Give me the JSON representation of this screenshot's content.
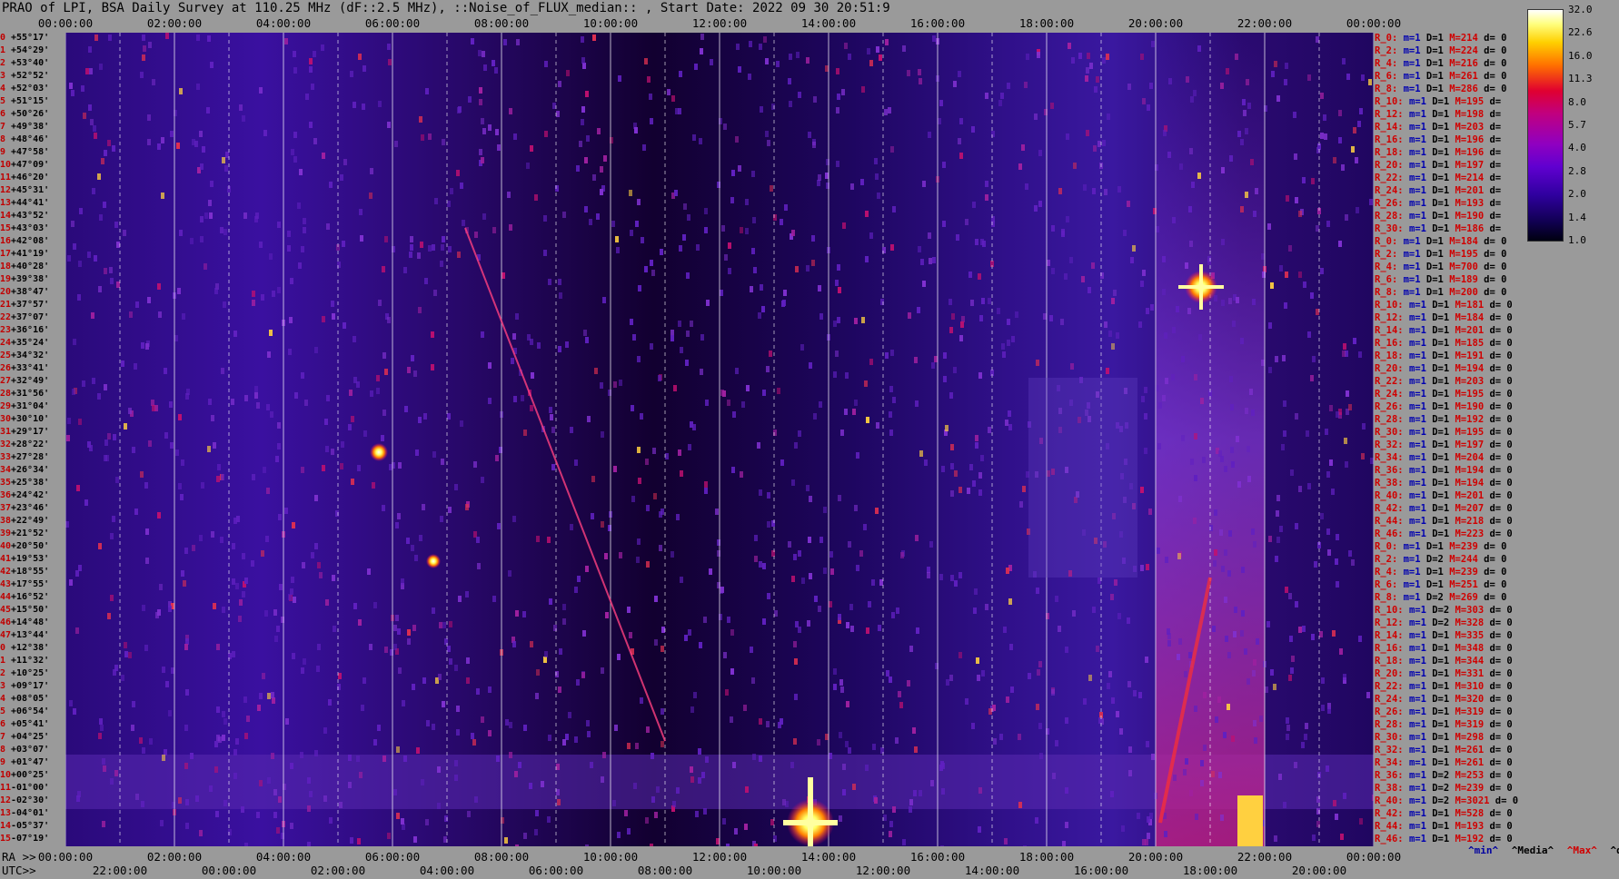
{
  "title": "PRAO of LPI, BSA Daily Survey at 110.25 MHz (dF::2.5 MHz), ::Noise_of_FLUX_median:: , Start Date: 2022 09 30 20:51:9",
  "top_axis_ticks": [
    "00:00:00",
    "02:00:00",
    "04:00:00",
    "06:00:00",
    "08:00:00",
    "10:00:00",
    "12:00:00",
    "14:00:00",
    "16:00:00",
    "18:00:00",
    "20:00:00",
    "22:00:00",
    "00:00:00"
  ],
  "ra_axis": {
    "prefix": "RA >>",
    "ticks": [
      "00:00:00",
      "02:00:00",
      "04:00:00",
      "06:00:00",
      "08:00:00",
      "10:00:00",
      "12:00:00",
      "14:00:00",
      "16:00:00",
      "18:00:00",
      "20:00:00",
      "22:00:00",
      "00:00:00"
    ]
  },
  "utc_axis": {
    "prefix": "UTC>>",
    "ticks": [
      "22:00:00",
      "00:00:00",
      "02:00:00",
      "04:00:00",
      "06:00:00",
      "08:00:00",
      "10:00:00",
      "12:00:00",
      "14:00:00",
      "16:00:00",
      "18:00:00",
      "20:00:00"
    ]
  },
  "declinations": [
    "+55°17'",
    "+54°29'",
    "+53°40'",
    "+52°52'",
    "+52°03'",
    "+51°15'",
    "+50°26'",
    "+49°38'",
    "+48°46'",
    "+47°58'",
    "+47°09'",
    "+46°20'",
    "+45°31'",
    "+44°41'",
    "+43°52'",
    "+43°03'",
    "+42°08'",
    "+41°19'",
    "+40°28'",
    "+39°38'",
    "+38°47'",
    "+37°57'",
    "+37°07'",
    "+36°16'",
    "+35°24'",
    "+34°32'",
    "+33°41'",
    "+32°49'",
    "+31°56'",
    "+31°04'",
    "+30°10'",
    "+29°17'",
    "+28°22'",
    "+27°28'",
    "+26°34'",
    "+25°38'",
    "+24°42'",
    "+23°46'",
    "+22°49'",
    "+21°52'",
    "+20°50'",
    "+19°53'",
    "+18°55'",
    "+17°55'",
    "+16°52'",
    "+15°50'",
    "+14°48'",
    "+13°44'",
    "+12°38'",
    "+11°32'",
    "+10°25'",
    "+09°17'",
    "+08°05'",
    "+06°54'",
    "+05°41'",
    "+04°25'",
    "+03°07'",
    "+01°47'",
    "+00°25'",
    "-01°00'",
    "-02°30'",
    "-04°01'",
    "-05°37'",
    "-07°19'"
  ],
  "dec_indices": [
    "0",
    "1",
    "2",
    "3",
    "4",
    "5",
    "6",
    "7",
    "8",
    "9",
    "10",
    "11",
    "12",
    "13",
    "14",
    "15",
    "16",
    "17",
    "18",
    "19",
    "20",
    "21",
    "22",
    "23",
    "24",
    "25",
    "26",
    "27",
    "28",
    "29",
    "30",
    "31",
    "32",
    "33",
    "34",
    "35",
    "36",
    "37",
    "38",
    "39",
    "40",
    "41",
    "42",
    "43",
    "44",
    "45",
    "46",
    "47",
    "0",
    "1",
    "2",
    "3",
    "4",
    "5",
    "6",
    "7",
    "8",
    "9",
    "10",
    "11",
    "12",
    "13",
    "14",
    "15"
  ],
  "colorbar": {
    "labels": [
      "32.0",
      "22.6",
      "16.0",
      "11.3",
      "8.0",
      "5.7",
      "4.0",
      "2.8",
      "2.0",
      "1.4",
      "1.0"
    ]
  },
  "stats": [
    {
      "r": "R_0:",
      "m": "m=1",
      "D": "D=1",
      "M": "M=214",
      "d": "d= 0"
    },
    {
      "r": "R_2:",
      "m": "m=1",
      "D": "D=1",
      "M": "M=224",
      "d": "d= 0"
    },
    {
      "r": "R_4:",
      "m": "m=1",
      "D": "D=1",
      "M": "M=216",
      "d": "d= 0"
    },
    {
      "r": "R_6:",
      "m": "m=1",
      "D": "D=1",
      "M": "M=261",
      "d": "d= 0"
    },
    {
      "r": "R_8:",
      "m": "m=1",
      "D": "D=1",
      "M": "M=286",
      "d": "d= 0"
    },
    {
      "r": "R_10:",
      "m": "m=1",
      "D": "D=1",
      "M": "M=195",
      "d": "d="
    },
    {
      "r": "R_12:",
      "m": "m=1",
      "D": "D=1",
      "M": "M=198",
      "d": "d="
    },
    {
      "r": "R_14:",
      "m": "m=1",
      "D": "D=1",
      "M": "M=203",
      "d": "d="
    },
    {
      "r": "R_16:",
      "m": "m=1",
      "D": "D=1",
      "M": "M=196",
      "d": "d="
    },
    {
      "r": "R_18:",
      "m": "m=1",
      "D": "D=1",
      "M": "M=196",
      "d": "d="
    },
    {
      "r": "R_20:",
      "m": "m=1",
      "D": "D=1",
      "M": "M=197",
      "d": "d="
    },
    {
      "r": "R_22:",
      "m": "m=1",
      "D": "D=1",
      "M": "M=214",
      "d": "d="
    },
    {
      "r": "R_24:",
      "m": "m=1",
      "D": "D=1",
      "M": "M=201",
      "d": "d="
    },
    {
      "r": "R_26:",
      "m": "m=1",
      "D": "D=1",
      "M": "M=193",
      "d": "d="
    },
    {
      "r": "R_28:",
      "m": "m=1",
      "D": "D=1",
      "M": "M=190",
      "d": "d="
    },
    {
      "r": "R_30:",
      "m": "m=1",
      "D": "D=1",
      "M": "M=186",
      "d": "d="
    },
    {
      "r": "R_0:",
      "m": "m=1",
      "D": "D=1",
      "M": "M=184",
      "d": "d= 0"
    },
    {
      "r": "R_2:",
      "m": "m=1",
      "D": "D=1",
      "M": "M=195",
      "d": "d= 0"
    },
    {
      "r": "R_4:",
      "m": "m=1",
      "D": "D=1",
      "M": "M=700",
      "d": "d= 0"
    },
    {
      "r": "R_6:",
      "m": "m=1",
      "D": "D=1",
      "M": "M=189",
      "d": "d= 0"
    },
    {
      "r": "R_8:",
      "m": "m=1",
      "D": "D=1",
      "M": "M=200",
      "d": "d= 0"
    },
    {
      "r": "R_10:",
      "m": "m=1",
      "D": "D=1",
      "M": "M=181",
      "d": "d= 0"
    },
    {
      "r": "R_12:",
      "m": "m=1",
      "D": "D=1",
      "M": "M=184",
      "d": "d= 0"
    },
    {
      "r": "R_14:",
      "m": "m=1",
      "D": "D=1",
      "M": "M=201",
      "d": "d= 0"
    },
    {
      "r": "R_16:",
      "m": "m=1",
      "D": "D=1",
      "M": "M=185",
      "d": "d= 0"
    },
    {
      "r": "R_18:",
      "m": "m=1",
      "D": "D=1",
      "M": "M=191",
      "d": "d= 0"
    },
    {
      "r": "R_20:",
      "m": "m=1",
      "D": "D=1",
      "M": "M=194",
      "d": "d= 0"
    },
    {
      "r": "R_22:",
      "m": "m=1",
      "D": "D=1",
      "M": "M=203",
      "d": "d= 0"
    },
    {
      "r": "R_24:",
      "m": "m=1",
      "D": "D=1",
      "M": "M=195",
      "d": "d= 0"
    },
    {
      "r": "R_26:",
      "m": "m=1",
      "D": "D=1",
      "M": "M=190",
      "d": "d= 0"
    },
    {
      "r": "R_28:",
      "m": "m=1",
      "D": "D=1",
      "M": "M=192",
      "d": "d= 0"
    },
    {
      "r": "R_30:",
      "m": "m=1",
      "D": "D=1",
      "M": "M=195",
      "d": "d= 0"
    },
    {
      "r": "R_32:",
      "m": "m=1",
      "D": "D=1",
      "M": "M=197",
      "d": "d= 0"
    },
    {
      "r": "R_34:",
      "m": "m=1",
      "D": "D=1",
      "M": "M=204",
      "d": "d= 0"
    },
    {
      "r": "R_36:",
      "m": "m=1",
      "D": "D=1",
      "M": "M=194",
      "d": "d= 0"
    },
    {
      "r": "R_38:",
      "m": "m=1",
      "D": "D=1",
      "M": "M=194",
      "d": "d= 0"
    },
    {
      "r": "R_40:",
      "m": "m=1",
      "D": "D=1",
      "M": "M=201",
      "d": "d= 0"
    },
    {
      "r": "R_42:",
      "m": "m=1",
      "D": "D=1",
      "M": "M=207",
      "d": "d= 0"
    },
    {
      "r": "R_44:",
      "m": "m=1",
      "D": "D=1",
      "M": "M=218",
      "d": "d= 0"
    },
    {
      "r": "R_46:",
      "m": "m=1",
      "D": "D=1",
      "M": "M=223",
      "d": "d= 0"
    },
    {
      "r": "R_0:",
      "m": "m=1",
      "D": "D=1",
      "M": "M=239",
      "d": "d= 0"
    },
    {
      "r": "R_2:",
      "m": "m=1",
      "D": "D=2",
      "M": "M=244",
      "d": "d= 0"
    },
    {
      "r": "R_4:",
      "m": "m=1",
      "D": "D=1",
      "M": "M=239",
      "d": "d= 0"
    },
    {
      "r": "R_6:",
      "m": "m=1",
      "D": "D=1",
      "M": "M=251",
      "d": "d= 0"
    },
    {
      "r": "R_8:",
      "m": "m=1",
      "D": "D=2",
      "M": "M=269",
      "d": "d= 0"
    },
    {
      "r": "R_10:",
      "m": "m=1",
      "D": "D=2",
      "M": "M=303",
      "d": "d= 0"
    },
    {
      "r": "R_12:",
      "m": "m=1",
      "D": "D=2",
      "M": "M=328",
      "d": "d= 0"
    },
    {
      "r": "R_14:",
      "m": "m=1",
      "D": "D=1",
      "M": "M=335",
      "d": "d= 0"
    },
    {
      "r": "R_16:",
      "m": "m=1",
      "D": "D=1",
      "M": "M=348",
      "d": "d= 0"
    },
    {
      "r": "R_18:",
      "m": "m=1",
      "D": "D=1",
      "M": "M=344",
      "d": "d= 0"
    },
    {
      "r": "R_20:",
      "m": "m=1",
      "D": "D=1",
      "M": "M=331",
      "d": "d= 0"
    },
    {
      "r": "R_22:",
      "m": "m=1",
      "D": "D=1",
      "M": "M=310",
      "d": "d= 0"
    },
    {
      "r": "R_24:",
      "m": "m=1",
      "D": "D=1",
      "M": "M=320",
      "d": "d= 0"
    },
    {
      "r": "R_26:",
      "m": "m=1",
      "D": "D=1",
      "M": "M=319",
      "d": "d= 0"
    },
    {
      "r": "R_28:",
      "m": "m=1",
      "D": "D=1",
      "M": "M=319",
      "d": "d= 0"
    },
    {
      "r": "R_30:",
      "m": "m=1",
      "D": "D=1",
      "M": "M=298",
      "d": "d= 0"
    },
    {
      "r": "R_32:",
      "m": "m=1",
      "D": "D=1",
      "M": "M=261",
      "d": "d= 0"
    },
    {
      "r": "R_34:",
      "m": "m=1",
      "D": "D=1",
      "M": "M=261",
      "d": "d= 0"
    },
    {
      "r": "R_36:",
      "m": "m=1",
      "D": "D=2",
      "M": "M=253",
      "d": "d= 0"
    },
    {
      "r": "R_38:",
      "m": "m=1",
      "D": "D=2",
      "M": "M=239",
      "d": "d= 0"
    },
    {
      "r": "R_40:",
      "m": "m=1",
      "D": "D=2",
      "M": "M=3021",
      "d": "d= 0"
    },
    {
      "r": "R_42:",
      "m": "m=1",
      "D": "D=1",
      "M": "M=528",
      "d": "d= 0"
    },
    {
      "r": "R_44:",
      "m": "m=1",
      "D": "D=1",
      "M": "M=193",
      "d": "d= 0"
    },
    {
      "r": "R_46:",
      "m": "m=1",
      "D": "D=1",
      "M": "M=192",
      "d": "d= 0"
    }
  ],
  "legend": {
    "min": "^min^",
    "median": "^Media^",
    "max": "^Max^",
    "devia": "^devia^"
  },
  "colors": {
    "background": "#9a9a9a",
    "plot_background": "#14003a",
    "label_red": "#d00000",
    "label_blue": "#0000b0"
  }
}
